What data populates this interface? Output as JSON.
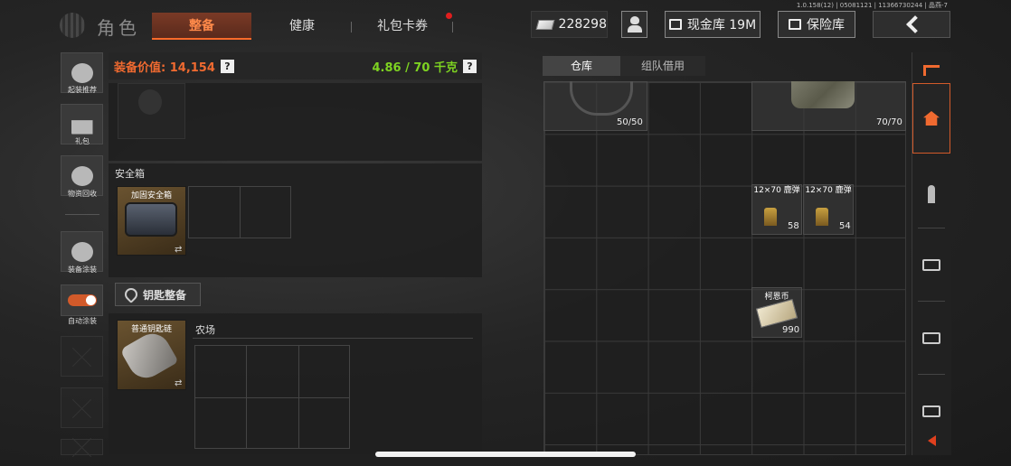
{
  "version": "1.0.158(12) | 05081121 | 11366730244 | 晶燕-7",
  "header": {
    "title": "角色",
    "tabs": [
      {
        "label": "整备",
        "active": true
      },
      {
        "label": "健康",
        "active": false
      },
      {
        "label": "礼包卡券",
        "active": false,
        "badge": true
      }
    ],
    "money": "228298",
    "cash_vault": "现金库 19M",
    "safe_vault": "保险库"
  },
  "sidebar": {
    "items": [
      {
        "label": "起装推荐",
        "icon": "loadout-recommend-icon"
      },
      {
        "label": "礼包",
        "icon": "gift-icon"
      },
      {
        "label": "物资回收",
        "icon": "recycle-icon"
      },
      {
        "label": "装备涂装",
        "icon": "paint-icon"
      },
      {
        "label": "自动涂装",
        "icon": "toggle-icon",
        "toggled": true
      }
    ]
  },
  "equipment": {
    "value_label": "装备价值: 14,154",
    "weight": "4.86 / 70 千克",
    "safe_section": "安全箱",
    "safe_item": "加固安全箱",
    "key_bar": "钥匙整备",
    "key_item": "普通钥匙链",
    "farm_label": "农场"
  },
  "storage": {
    "tabs": [
      {
        "label": "仓库",
        "active": true
      },
      {
        "label": "组队借用",
        "active": false
      }
    ],
    "items": [
      {
        "count": "50/50"
      },
      {
        "count": "70/70"
      },
      {
        "name": "12×70 鹿弹",
        "count": "58"
      },
      {
        "name": "12×70 鹿弹",
        "count": "54"
      },
      {
        "name": "柯恩币",
        "count": "990"
      }
    ]
  },
  "colors": {
    "accent": "#f06a30",
    "weight_green": "#7ed321",
    "badge_red": "#e01e1e"
  }
}
